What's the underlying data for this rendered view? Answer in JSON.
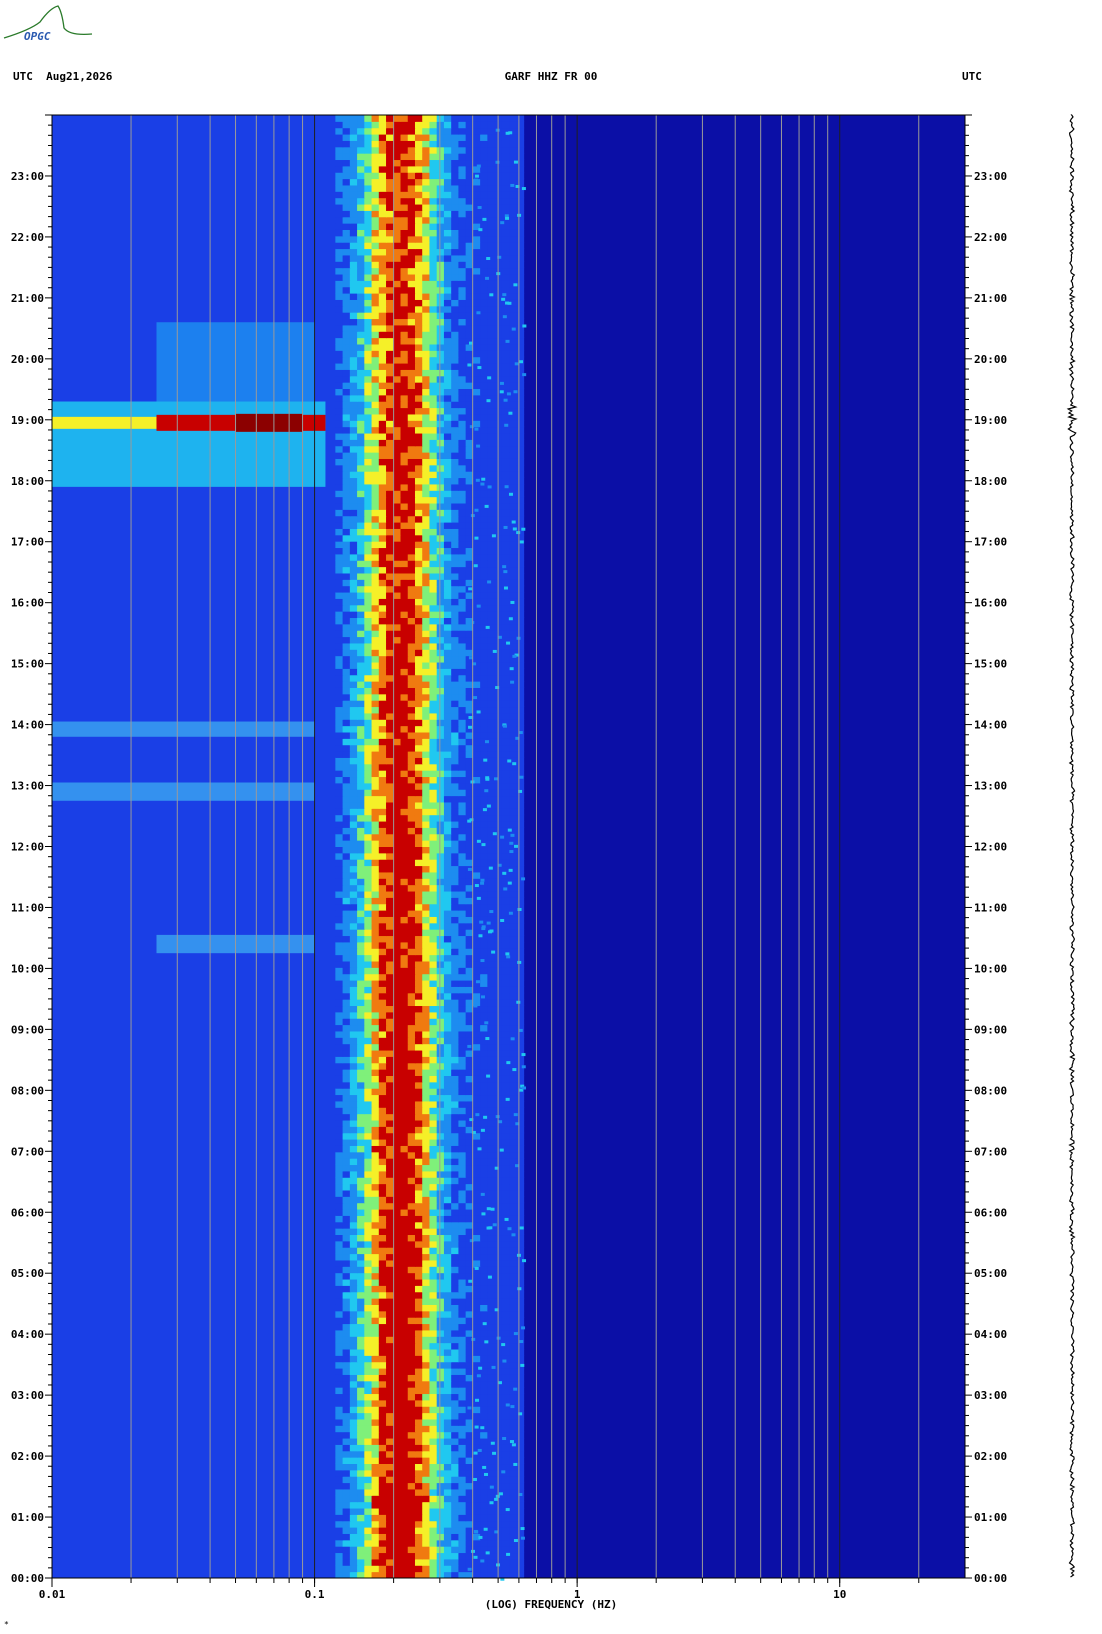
{
  "header": {
    "left": "UTC  Aug21,2026",
    "center": "GARF HHZ FR 00",
    "right": "UTC"
  },
  "logo": {
    "text": "OPGC"
  },
  "footer": {
    "mark": "*"
  },
  "colors": {
    "background_low": "#0b0fa6",
    "blue": "#1a3fe6",
    "cyan": "#20c8f0",
    "yellow": "#f5f028",
    "orange": "#f07a10",
    "red": "#c80000",
    "darkred": "#8c0000"
  },
  "chart_data": {
    "type": "heatmap",
    "title": "GARF HHZ FR 00",
    "xlabel": "(LOG) FREQUENCY (HZ)",
    "ylabel": "UTC",
    "x_scale": "log",
    "xlim": [
      0.01,
      30
    ],
    "x_tick_labels": [
      "0.01",
      "0.1",
      "1",
      "10"
    ],
    "x_ticks": [
      0.01,
      0.1,
      1,
      10
    ],
    "y_tick_labels": [
      "00:00",
      "01:00",
      "02:00",
      "03:00",
      "04:00",
      "05:00",
      "06:00",
      "07:00",
      "08:00",
      "09:00",
      "10:00",
      "11:00",
      "12:00",
      "13:00",
      "14:00",
      "15:00",
      "16:00",
      "17:00",
      "18:00",
      "19:00",
      "20:00",
      "21:00",
      "22:00",
      "23:00"
    ],
    "ylim_hours": [
      0,
      24
    ],
    "grid_frequencies": [
      0.02,
      0.03,
      0.04,
      0.05,
      0.06,
      0.07,
      0.08,
      0.09,
      0.1,
      0.2,
      0.3,
      0.4,
      0.5,
      0.6,
      0.7,
      0.8,
      0.9,
      1,
      2,
      3,
      4,
      5,
      6,
      7,
      8,
      9,
      10,
      20
    ],
    "microseism_band_hz": [
      0.12,
      0.5
    ],
    "peak_band_hz": [
      0.16,
      0.28
    ],
    "events": [
      {
        "start_hour": 17.9,
        "end_hour": 19.3,
        "f_low": 0.01,
        "f_high": 0.11,
        "peak_hour": 18.95,
        "intensity": "strong"
      },
      {
        "start_hour": 19.3,
        "end_hour": 20.6,
        "f_low": 0.025,
        "f_high": 0.1,
        "intensity": "moderate"
      },
      {
        "start_hour": 13.8,
        "end_hour": 14.05,
        "f_low": 0.01,
        "f_high": 0.1,
        "intensity": "weak"
      },
      {
        "start_hour": 12.75,
        "end_hour": 13.05,
        "f_low": 0.01,
        "f_high": 0.1,
        "intensity": "weak"
      },
      {
        "start_hour": 10.25,
        "end_hour": 10.55,
        "f_low": 0.025,
        "f_high": 0.1,
        "intensity": "weak"
      }
    ],
    "grid": true
  }
}
